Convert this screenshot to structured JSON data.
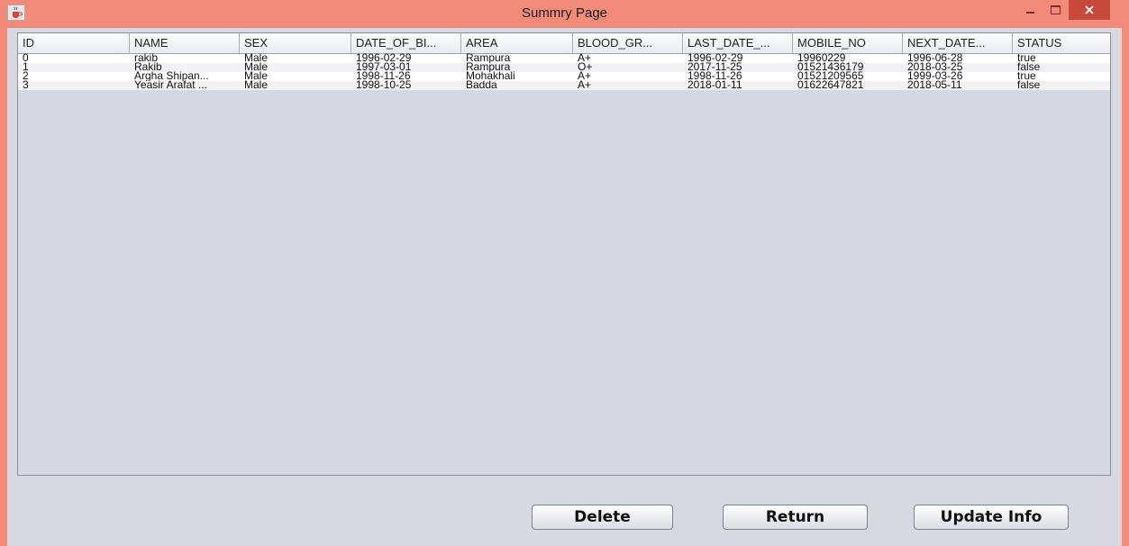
{
  "window": {
    "title": "Summry Page",
    "accent_color": "#f28b7a",
    "close_color": "#c7493c"
  },
  "table": {
    "columns": [
      "ID",
      "NAME",
      "SEX",
      "DATE_OF_BI...",
      "AREA",
      "BLOOD_GR...",
      "LAST_DATE_...",
      "MOBILE_NO",
      "NEXT_DATE...",
      "STATUS"
    ],
    "rows": [
      [
        "0",
        "rakib",
        "Male",
        "1996-02-29",
        "Rampura",
        "A+",
        "1996-02-29",
        "19960229",
        "1996-06-28",
        "true"
      ],
      [
        "1",
        "Rakib",
        "Male",
        "1997-03-01",
        "Rampura",
        "O+",
        "2017-11-25",
        "01521436179",
        "2018-03-25",
        "false"
      ],
      [
        "2",
        "Argha Shipan...",
        "Male",
        "1998-11-26",
        "Mohakhali",
        "A+",
        "1998-11-26",
        "01521209565",
        "1999-03-26",
        "true"
      ],
      [
        "3",
        "Yeasir Arafat ...",
        "Male",
        "1998-10-25",
        "Badda",
        "A+",
        "2018-01-11",
        "01622647821",
        "2018-05-11",
        "false"
      ]
    ]
  },
  "buttons": {
    "delete": "Delete",
    "return": "Return",
    "update": "Update Info"
  },
  "icons": {
    "app": "java-cup-icon",
    "minimize": "minimize-icon",
    "maximize": "maximize-icon",
    "close": "close-icon"
  }
}
